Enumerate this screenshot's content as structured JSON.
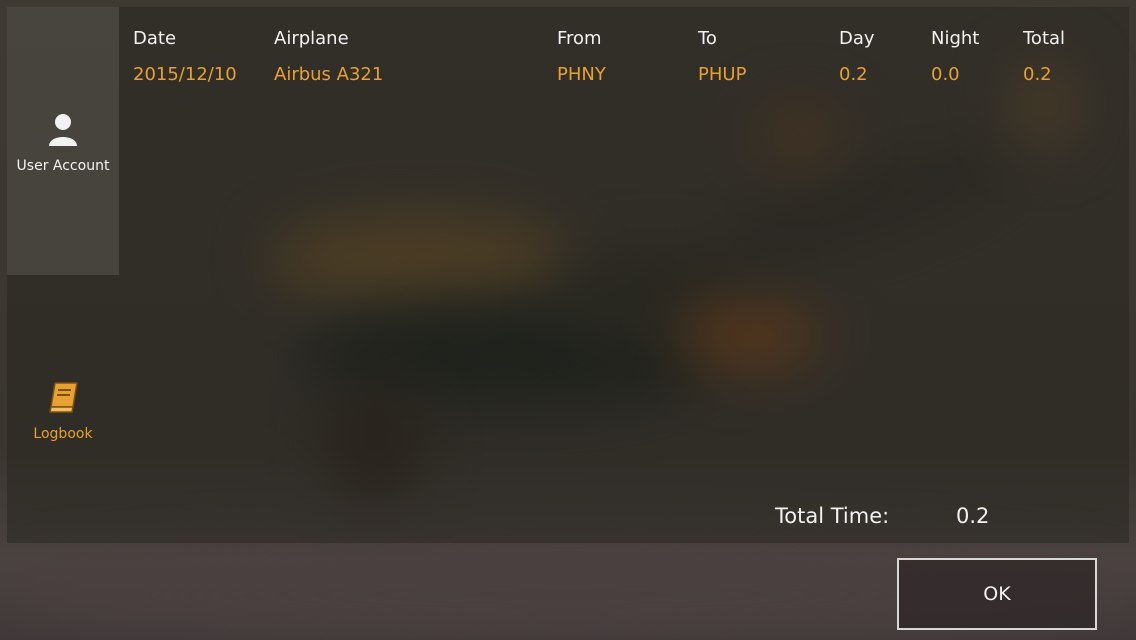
{
  "sidebar": {
    "items": [
      {
        "label": "User Account",
        "icon": "user-icon",
        "active": false
      },
      {
        "label": "Logbook",
        "icon": "book-icon",
        "active": true
      }
    ]
  },
  "table": {
    "headers": {
      "date": "Date",
      "airplane": "Airplane",
      "from": "From",
      "to": "To",
      "day": "Day",
      "night": "Night",
      "total": "Total"
    },
    "rows": [
      {
        "date": "2015/12/10",
        "airplane": "Airbus A321",
        "from": "PHNY",
        "to": "PHUP",
        "day": "0.2",
        "night": "0.0",
        "total": "0.2"
      }
    ]
  },
  "summary": {
    "label": "Total Time:",
    "value": "0.2"
  },
  "buttons": {
    "ok": "OK"
  },
  "colors": {
    "accent": "#e8a030",
    "text": "#f2f2f2"
  }
}
